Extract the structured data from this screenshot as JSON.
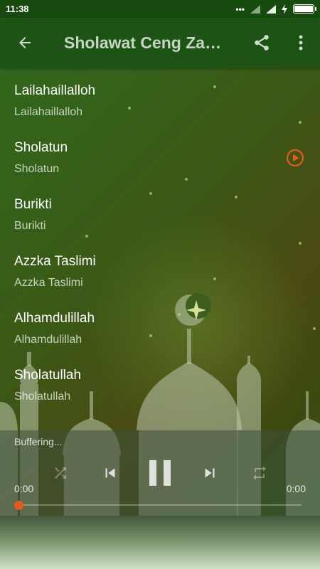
{
  "status_bar": {
    "time": "11:38",
    "signal_text": "•••",
    "battery_icon": "battery-full-icon"
  },
  "toolbar": {
    "title": "Sholawat Ceng Zam Zam",
    "back_icon": "arrow-back-icon",
    "share_icon": "share-icon",
    "menu_icon": "more-vert-icon"
  },
  "tracks": [
    {
      "title": "Lailahaillalloh",
      "subtitle": "Lailahaillalloh",
      "playing": false
    },
    {
      "title": "Sholatun",
      "subtitle": "Sholatun",
      "playing": true
    },
    {
      "title": "Burikti",
      "subtitle": "Burikti",
      "playing": false
    },
    {
      "title": "Azzka Taslimi",
      "subtitle": "Azzka Taslimi",
      "playing": false
    },
    {
      "title": "Alhamdulillah",
      "subtitle": "Alhamdulillah",
      "playing": false
    },
    {
      "title": "Sholatullah",
      "subtitle": "Sholatullah",
      "playing": false
    }
  ],
  "player": {
    "status": "Buffering...",
    "elapsed": "0:00",
    "duration": "0:00",
    "progress": 0,
    "controls": [
      "shuffle-icon",
      "skip-previous-icon",
      "pause-icon",
      "skip-next-icon",
      "repeat-icon"
    ]
  },
  "colors": {
    "accent": "#e35a1f",
    "toolbar": "#1d5315",
    "status_bar": "#164a0f"
  }
}
